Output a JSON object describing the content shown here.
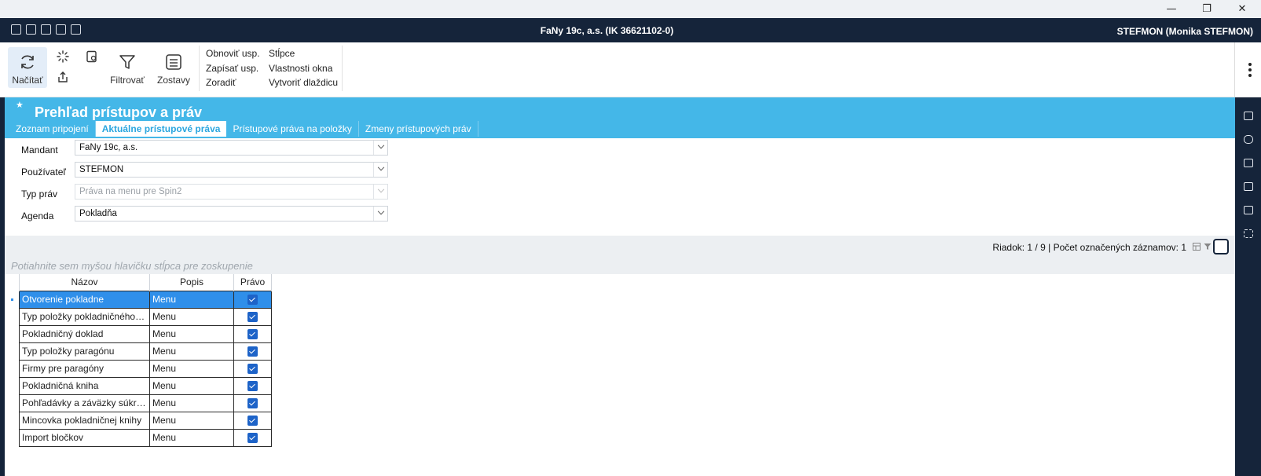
{
  "window": {
    "title": "FaNy 19c, a.s. (IK 36621102-0)",
    "user": "STEFMON (Monika STEFMON)"
  },
  "ribbon": {
    "load_label": "Načítať",
    "filter_label": "Filtrovať",
    "reports_label": "Zostavy",
    "links_col1": [
      "Obnoviť usp.",
      "Zapísať usp.",
      "Zoradiť"
    ],
    "links_col2": [
      "Stĺpce",
      "Vlastnosti okna",
      "Vytvoriť dlaždicu"
    ]
  },
  "page": {
    "title": "Prehľad prístupov a práv",
    "tabs": [
      {
        "label": "Zoznam pripojení",
        "active": false
      },
      {
        "label": "Aktuálne prístupové práva",
        "active": true
      },
      {
        "label": "Prístupové práva na položky",
        "active": false
      },
      {
        "label": "Zmeny prístupových práv",
        "active": false
      }
    ]
  },
  "filters": {
    "mandant": {
      "label": "Mandant",
      "value": "FaNy 19c, a.s."
    },
    "user": {
      "label": "Používateľ",
      "value": "STEFMON"
    },
    "rights_type": {
      "label": "Typ práv",
      "value": "Práva na menu pre Spin2",
      "disabled": true
    },
    "agenda": {
      "label": "Agenda",
      "value": "Pokladňa"
    }
  },
  "status": {
    "text": "Riadok: 1 / 9 | Počet označených záznamov: 1"
  },
  "group_band": {
    "hint": "Potiahnite sem myšou hlavičku stĺpca pre zoskupenie"
  },
  "grid": {
    "columns": [
      "Názov",
      "Popis",
      "Právo"
    ],
    "rows": [
      {
        "name": "Otvorenie pokladne",
        "popis": "Menu",
        "pravo": true
      },
      {
        "name": "Typ položky pokladničného dokladu",
        "popis": "Menu",
        "pravo": true
      },
      {
        "name": "Pokladničný doklad",
        "popis": "Menu",
        "pravo": true
      },
      {
        "name": "Typ položky paragónu",
        "popis": "Menu",
        "pravo": true
      },
      {
        "name": "Firmy pre paragóny",
        "popis": "Menu",
        "pravo": true
      },
      {
        "name": "Pokladničná kniha",
        "popis": "Menu",
        "pravo": true
      },
      {
        "name": "Pohľadávky a záväzky súkromných osôb",
        "popis": "Menu",
        "pravo": true
      },
      {
        "name": "Mincovka pokladničnej knihy",
        "popis": "Menu",
        "pravo": true
      },
      {
        "name": "Import bločkov",
        "popis": "Menu",
        "pravo": true
      }
    ]
  },
  "colors": {
    "dark": "#15243a",
    "header_blue": "#44b7e8",
    "selection": "#2f8fea",
    "checkbox": "#1d63c8"
  }
}
